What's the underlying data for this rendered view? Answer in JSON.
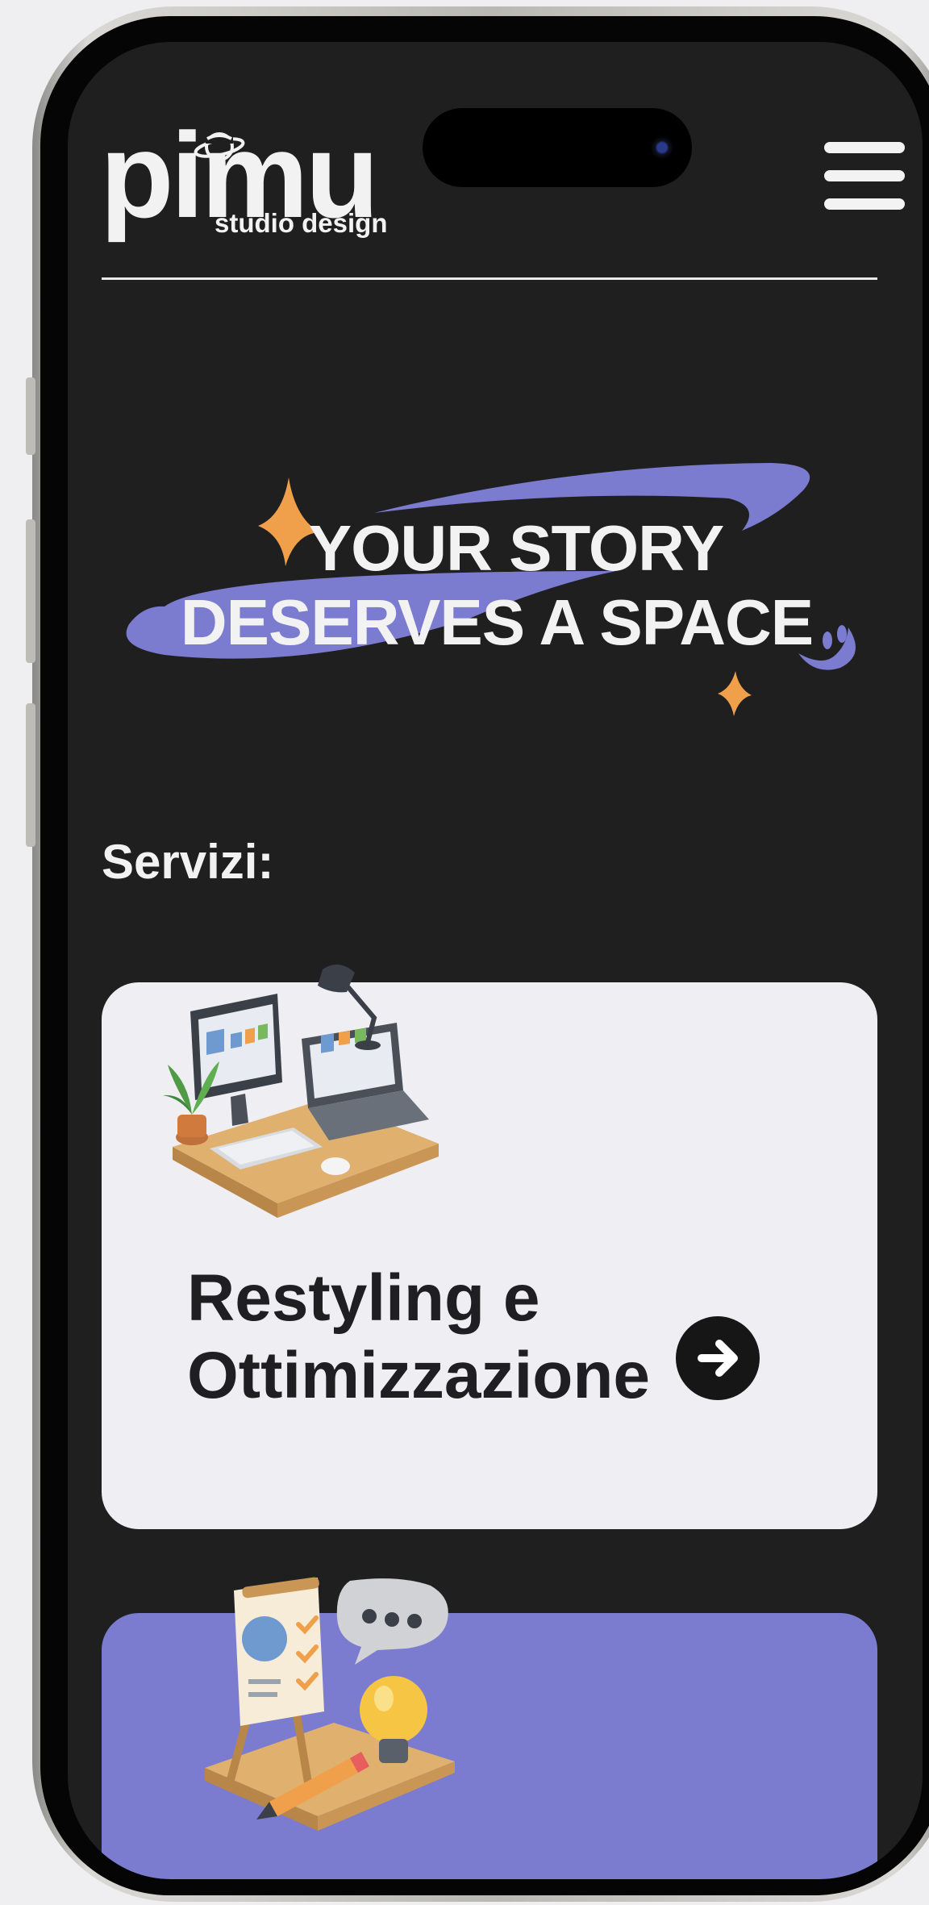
{
  "header": {
    "logo_word": "pimu",
    "logo_sub": "studio design",
    "menu_icon": "hamburger-menu-icon"
  },
  "hero": {
    "line1": "YOUR STORY",
    "line2": "DESERVES A SPACE"
  },
  "services": {
    "title": "Servizi:",
    "cards": [
      {
        "title": "Restyling e Ottimizzazione",
        "illustration": "desk-computer-illustration",
        "arrow_icon": "arrow-right-icon",
        "background": "#efeff3"
      },
      {
        "title": "",
        "illustration": "presentation-idea-illustration",
        "background": "#7b7bd0"
      }
    ]
  },
  "colors": {
    "screen_bg": "#1f1f20",
    "accent_purple": "#7b7bd0",
    "accent_orange": "#f0a04a",
    "text_light": "#f2f2f2"
  }
}
